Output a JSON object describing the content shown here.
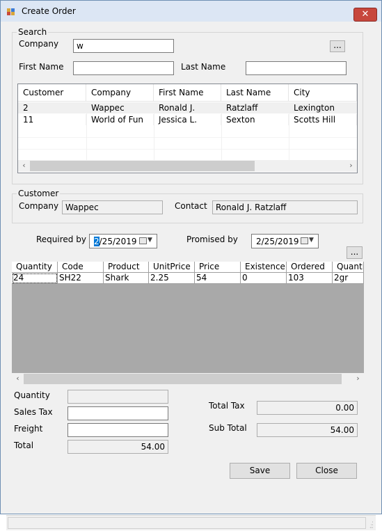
{
  "window": {
    "title": "Create Order",
    "close_label": "✕"
  },
  "search": {
    "group_label": "Search",
    "company_label": "Company",
    "company_value": "w",
    "first_name_label": "First Name",
    "first_name_value": "",
    "last_name_label": "Last Name",
    "last_name_value": "",
    "browse_label": "...",
    "results": {
      "columns": [
        "Customer",
        "Company",
        "First Name",
        "Last Name",
        "City"
      ],
      "rows": [
        [
          "2",
          "Wappec",
          "Ronald J.",
          "Ratzlaff",
          "Lexington"
        ],
        [
          "11",
          "World of Fun",
          "Jessica L.",
          "Sexton",
          "Scotts Hill"
        ]
      ]
    },
    "scroll_left": "‹",
    "scroll_right": "›"
  },
  "customer": {
    "group_label": "Customer",
    "company_label": "Company",
    "company_value": "Wappec",
    "contact_label": "Contact",
    "contact_value": "Ronald J. Ratzlaff"
  },
  "dates": {
    "required_label": "Required by",
    "required_month": "2",
    "required_rest": "/25/2019",
    "promised_label": "Promised by",
    "promised_value": "2/25/2019",
    "browse_label": "..."
  },
  "items": {
    "columns": [
      "Quantity",
      "Code",
      "Product",
      "UnitPrice",
      "Price",
      "Existence",
      "Ordered",
      "Quantity"
    ],
    "rows": [
      [
        "24",
        "SH22",
        "Shark",
        "2.25",
        "54",
        "0",
        "103",
        "2gr"
      ]
    ],
    "scroll_left": "‹",
    "scroll_right": "›"
  },
  "totals": {
    "quantity_label": "Quantity",
    "quantity_value": "",
    "sales_tax_label": "Sales Tax",
    "sales_tax_value": "",
    "freight_label": "Freight",
    "freight_value": "",
    "total_label": "Total",
    "total_value": "54.00",
    "total_tax_label": "Total Tax",
    "total_tax_value": "0.00",
    "sub_total_label": "Sub Total",
    "sub_total_value": "54.00"
  },
  "buttons": {
    "save_label": "Save",
    "close_label": "Close"
  },
  "colors": {
    "title_bar": "#dce6f4",
    "close_button": "#c7473d",
    "selection": "#0078d7",
    "grid_background": "#a9a9a9"
  }
}
